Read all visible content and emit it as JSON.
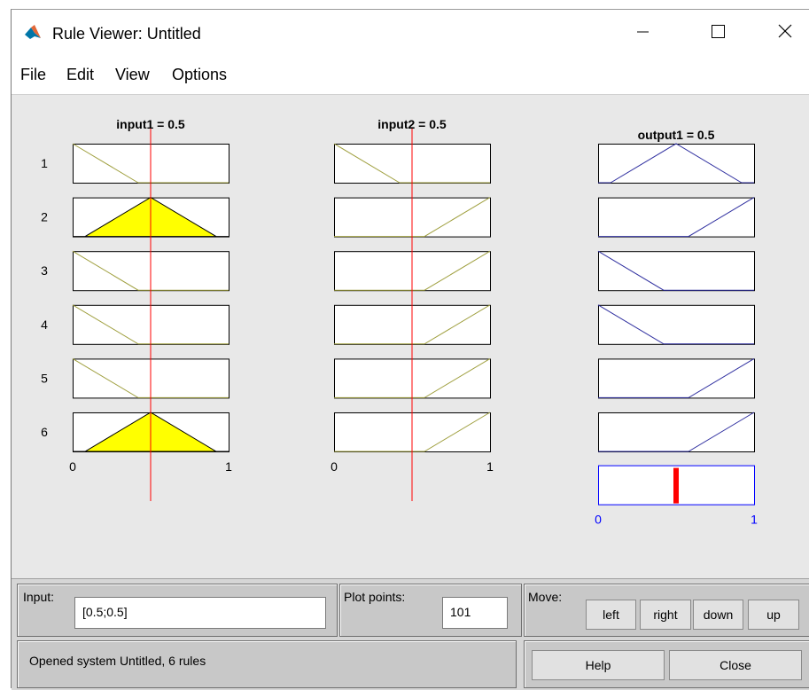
{
  "window": {
    "title": "Rule Viewer: Untitled"
  },
  "menu": {
    "items": [
      "File",
      "Edit",
      "View",
      "Options"
    ]
  },
  "plots": {
    "input1": {
      "title": "input1 = 0.5",
      "value": 0.5,
      "axis_min": "0",
      "axis_max": "1"
    },
    "input2": {
      "title": "input2 = 0.5",
      "value": 0.5,
      "axis_min": "0",
      "axis_max": "1"
    },
    "output1": {
      "title": "output1 = 0.5",
      "value": 0.5,
      "axis_min": "0",
      "axis_max": "1"
    }
  },
  "rules": [
    {
      "number": "1",
      "in1": "low",
      "in2": "low",
      "out": "mid",
      "in1_active": false
    },
    {
      "number": "2",
      "in1": "mid",
      "in2": "high",
      "out": "high",
      "in1_active": true
    },
    {
      "number": "3",
      "in1": "low",
      "in2": "high",
      "out": "low",
      "in1_active": false
    },
    {
      "number": "4",
      "in1": "low",
      "in2": "high",
      "out": "low",
      "in1_active": false
    },
    {
      "number": "5",
      "in1": "low",
      "in2": "high",
      "out": "high",
      "in1_active": false
    },
    {
      "number": "6",
      "in1": "mid",
      "in2": "high",
      "out": "high",
      "in1_active": true
    }
  ],
  "controls": {
    "input_label": "Input:",
    "input_value": "[0.5;0.5]",
    "plot_points_label": "Plot points:",
    "plot_points_value": "101",
    "move_label": "Move:",
    "move_buttons": [
      "left",
      "right",
      "down",
      "up"
    ],
    "status_text": "Opened system Untitled, 6 rules",
    "help_label": "Help",
    "close_label": "Close"
  },
  "colors": {
    "input_mf_line": "#a0a040",
    "output_mf_line": "#3030a0",
    "fill_active": "#ffff00",
    "indicator_line": "#ff0000",
    "output_axis": "#0000ff"
  }
}
